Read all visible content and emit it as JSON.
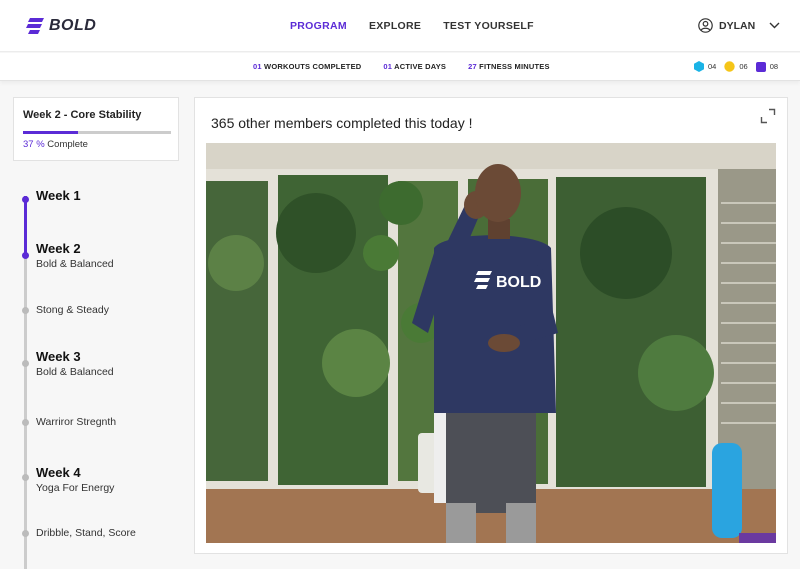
{
  "app": {
    "logo_text": "BOLD"
  },
  "nav": {
    "links": [
      {
        "label": "PROGRAM",
        "active": true
      },
      {
        "label": "EXPLORE",
        "active": false
      },
      {
        "label": "TEST YOURSELF",
        "active": false
      }
    ],
    "user_name": "DYLAN"
  },
  "stats": [
    {
      "value": "01",
      "label": "WORKOUTS COMPLETED"
    },
    {
      "value": "01",
      "label": "ACTIVE DAYS"
    },
    {
      "value": "27",
      "label": "FITNESS MINUTES"
    }
  ],
  "badges": [
    {
      "icon": "hexagon-icon",
      "color": "#1ab3e6",
      "value": "04"
    },
    {
      "icon": "circle-icon",
      "color": "#f5c518",
      "value": "06"
    },
    {
      "icon": "rounded-square-icon",
      "color": "#5b2bd6",
      "value": "08"
    }
  ],
  "progress": {
    "title": "Week 2 - Core Stability",
    "percent": 37,
    "percent_label": "37 %",
    "complete_label": "Complete"
  },
  "timeline": {
    "items": [
      {
        "kind": "week",
        "title": "Week 1",
        "subtitle": ""
      },
      {
        "kind": "week",
        "title": "Week 2",
        "subtitle": "Bold & Balanced"
      },
      {
        "kind": "session",
        "title": "",
        "subtitle": "Stong & Steady"
      },
      {
        "kind": "week",
        "title": "Week 3",
        "subtitle": "Bold & Balanced"
      },
      {
        "kind": "session",
        "title": "",
        "subtitle": "Warriror Stregnth"
      },
      {
        "kind": "week",
        "title": "Week 4",
        "subtitle": "Yoga For Energy"
      },
      {
        "kind": "session",
        "title": "",
        "subtitle": "Dribble, Stand, Score"
      }
    ]
  },
  "main": {
    "completed_text": "365 other members completed this today !",
    "video_shirt_text": "BOLD",
    "colors": {
      "accent": "#5b2bd6"
    }
  }
}
